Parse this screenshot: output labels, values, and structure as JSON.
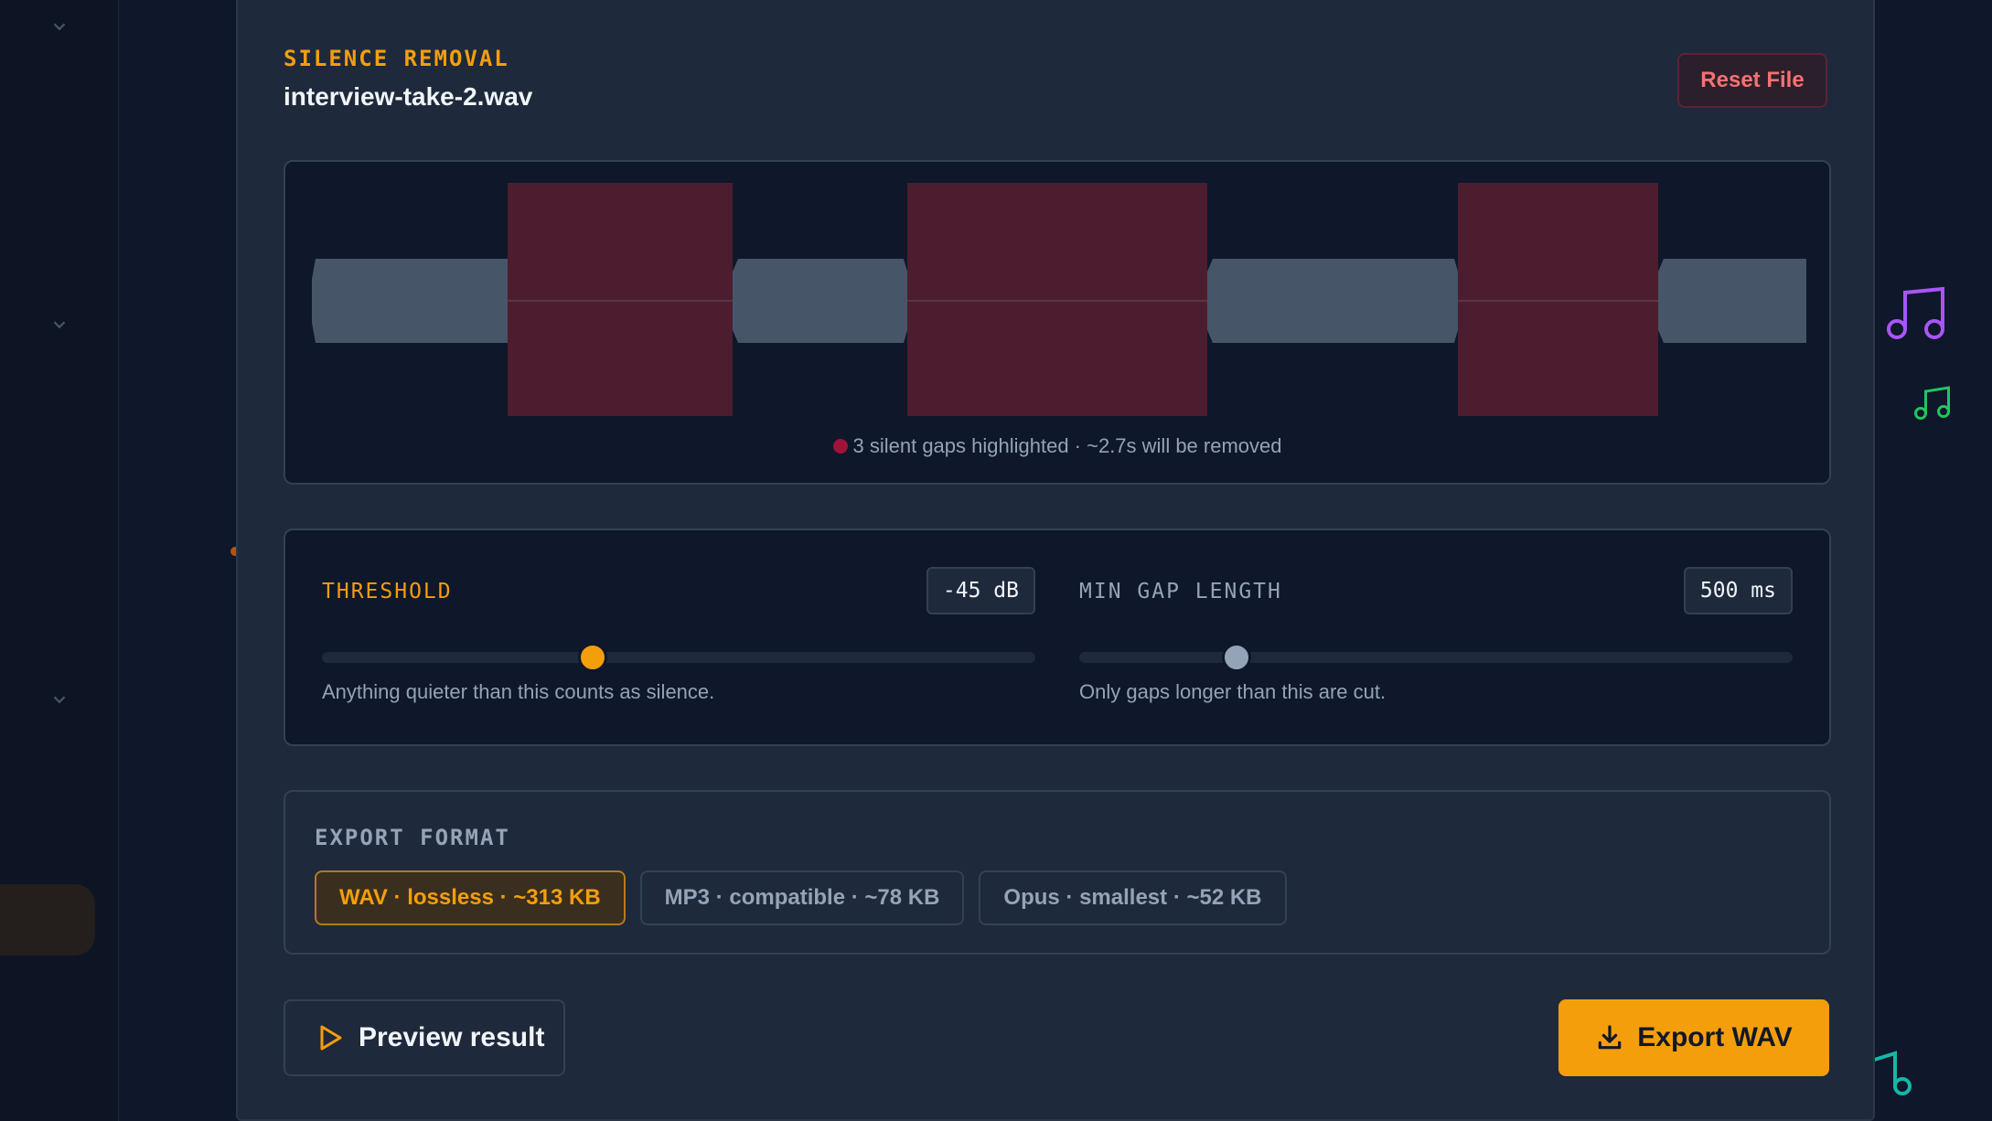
{
  "header": {
    "eyebrow": "SILENCE REMOVAL",
    "filename": "interview-take-2.wav",
    "reset_label": "Reset File"
  },
  "waveform": {
    "caption": "3 silent gaps highlighted · ~2.7s will be removed",
    "silent_gap_color": "#4c1d2e",
    "audio_color": "#475569"
  },
  "threshold": {
    "label": "THRESHOLD",
    "value": "-45 dB",
    "hint": "Anything quieter than this counts as silence.",
    "position_fraction": 0.38,
    "color": "#f59e0b"
  },
  "min_gap": {
    "label": "MIN GAP LENGTH",
    "value": "500 ms",
    "hint": "Only gaps longer than this are cut.",
    "position_fraction": 0.22,
    "color": "#94a3b8"
  },
  "export": {
    "title": "EXPORT FORMAT",
    "formats": [
      {
        "label": "WAV · lossless · ~313 KB",
        "selected": true
      },
      {
        "label": "MP3 · compatible · ~78 KB",
        "selected": false
      },
      {
        "label": "Opus · smallest · ~52 KB",
        "selected": false
      }
    ]
  },
  "actions": {
    "preview_label": "Preview result",
    "export_label": "Export WAV"
  },
  "colors": {
    "accent": "#f59e0b",
    "danger": "#f87171",
    "panel": "#1e293b",
    "background": "#0f172a"
  }
}
